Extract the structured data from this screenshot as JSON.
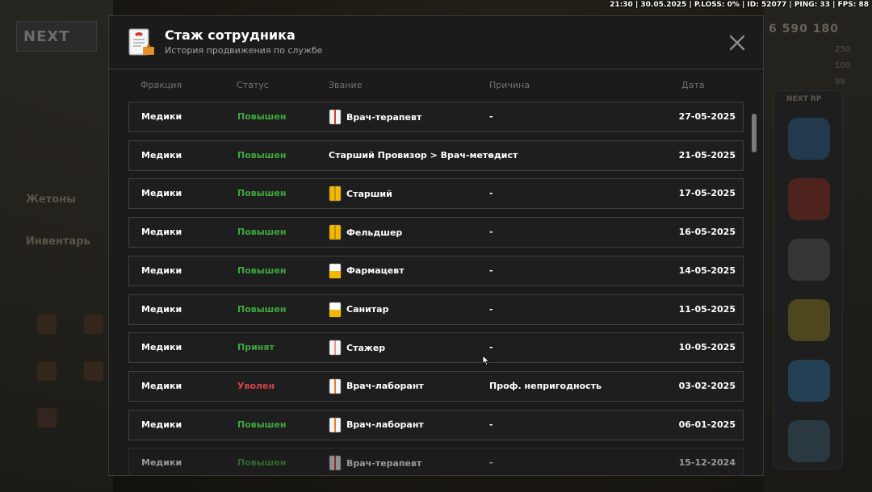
{
  "hud": {
    "text": "21:30 | 30.05.2025 | P.LOSS: 0% | ID: 52077 | PING: 33 | FPS: 88"
  },
  "background": {
    "logo": "NEXT",
    "left_labels": [
      "Жетоны",
      "Инвентарь"
    ],
    "money": "6 590 180",
    "stats": [
      "250",
      "100",
      "99"
    ],
    "shop_title": "NEXT RP"
  },
  "modal": {
    "icon": "document-badge-icon",
    "title": "Стаж сотрудника",
    "subtitle": "История продвижения по службе",
    "close_icon": "close-icon",
    "columns": {
      "fraction": "Фракция",
      "status": "Статус",
      "rank": "Звание",
      "reason": "Причина",
      "date": "Дата"
    },
    "rows": [
      {
        "fraction": "Медики",
        "status": "Повышен",
        "status_type": "promoted",
        "rank": "Врач-терапевт",
        "rank_icon": "white-red-coat",
        "reason": "-",
        "date": "27-05-2025"
      },
      {
        "fraction": "Медики",
        "status": "Повышен",
        "status_type": "promoted",
        "rank": "Старший Провизор > Врач-методист",
        "rank_icon": "",
        "reason": "-",
        "date": "21-05-2025"
      },
      {
        "fraction": "Медики",
        "status": "Повышен",
        "status_type": "promoted",
        "rank": "Старший",
        "rank_icon": "yellow-coat",
        "reason": "-",
        "date": "17-05-2025"
      },
      {
        "fraction": "Медики",
        "status": "Повышен",
        "status_type": "promoted",
        "rank": "Фельдшер",
        "rank_icon": "yellow-coat",
        "reason": "-",
        "date": "16-05-2025"
      },
      {
        "fraction": "Медики",
        "status": "Повышен",
        "status_type": "promoted",
        "rank": "Фармацевт",
        "rank_icon": "white-yellow-coat",
        "reason": "-",
        "date": "14-05-2025"
      },
      {
        "fraction": "Медики",
        "status": "Повышен",
        "status_type": "promoted",
        "rank": "Санитар",
        "rank_icon": "white-yellow-coat",
        "reason": "-",
        "date": "11-05-2025"
      },
      {
        "fraction": "Медики",
        "status": "Принят",
        "status_type": "hired",
        "rank": "Стажер",
        "rank_icon": "white-coat",
        "reason": "-",
        "date": "10-05-2025"
      },
      {
        "fraction": "Медики",
        "status": "Уволен",
        "status_type": "fired",
        "rank": "Врач-лаборант",
        "rank_icon": "white-orange-coat",
        "reason": "Проф. непригодность",
        "date": "03-02-2025"
      },
      {
        "fraction": "Медики",
        "status": "Повышен",
        "status_type": "promoted",
        "rank": "Врач-лаборант",
        "rank_icon": "white-orange-coat",
        "reason": "-",
        "date": "06-01-2025"
      },
      {
        "fraction": "Медики",
        "status": "Повышен",
        "status_type": "promoted",
        "rank": "Врач-терапевт",
        "rank_icon": "white-red-coat",
        "reason": "-",
        "date": "15-12-2024"
      }
    ]
  },
  "colors": {
    "promoted": "#3fa93f",
    "hired": "#3fa93f",
    "fired": "#d64545",
    "modal_bg": "#1b1b1b",
    "row_border": "#3f3f3f"
  }
}
